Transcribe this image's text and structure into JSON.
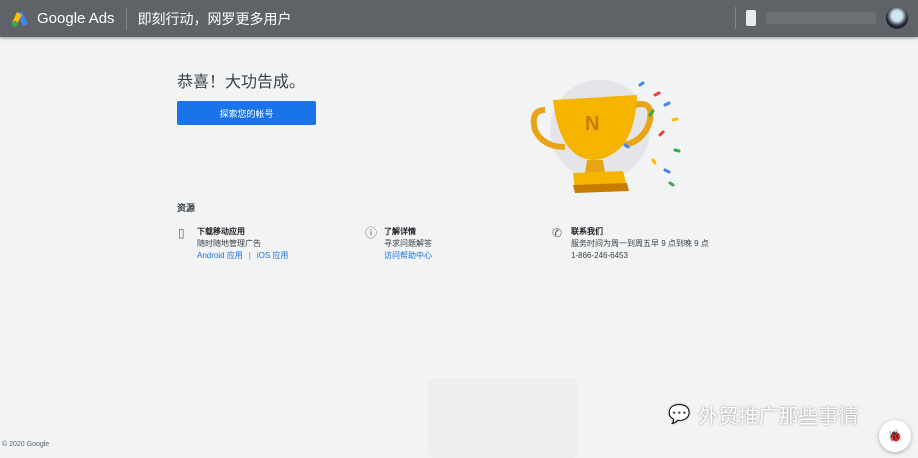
{
  "header": {
    "brand": "Google Ads",
    "slogan": "即刻行动，网罗更多用户"
  },
  "main": {
    "title": "恭喜！大功告成。",
    "explore_button": "探索您的帐号"
  },
  "resources": {
    "title": "资源",
    "items": [
      {
        "title": "下载移动应用",
        "desc": "随时随地管理广告",
        "link1": "Android 应用",
        "divider": "|",
        "link2": "iOS 应用"
      },
      {
        "title": "了解详情",
        "desc": "寻求问题解答",
        "link1": "访问帮助中心"
      },
      {
        "title": "联系我们",
        "desc": "服务时间为周一到周五早 9 点到晚 9 点",
        "phone": "1-866-246-6453"
      }
    ]
  },
  "footer": {
    "copyright": "© 2020 Google"
  },
  "watermark": {
    "text": "外贸推广那些事情"
  },
  "colors": {
    "accent": "#1a73e8",
    "topbar": "#5f6368"
  }
}
